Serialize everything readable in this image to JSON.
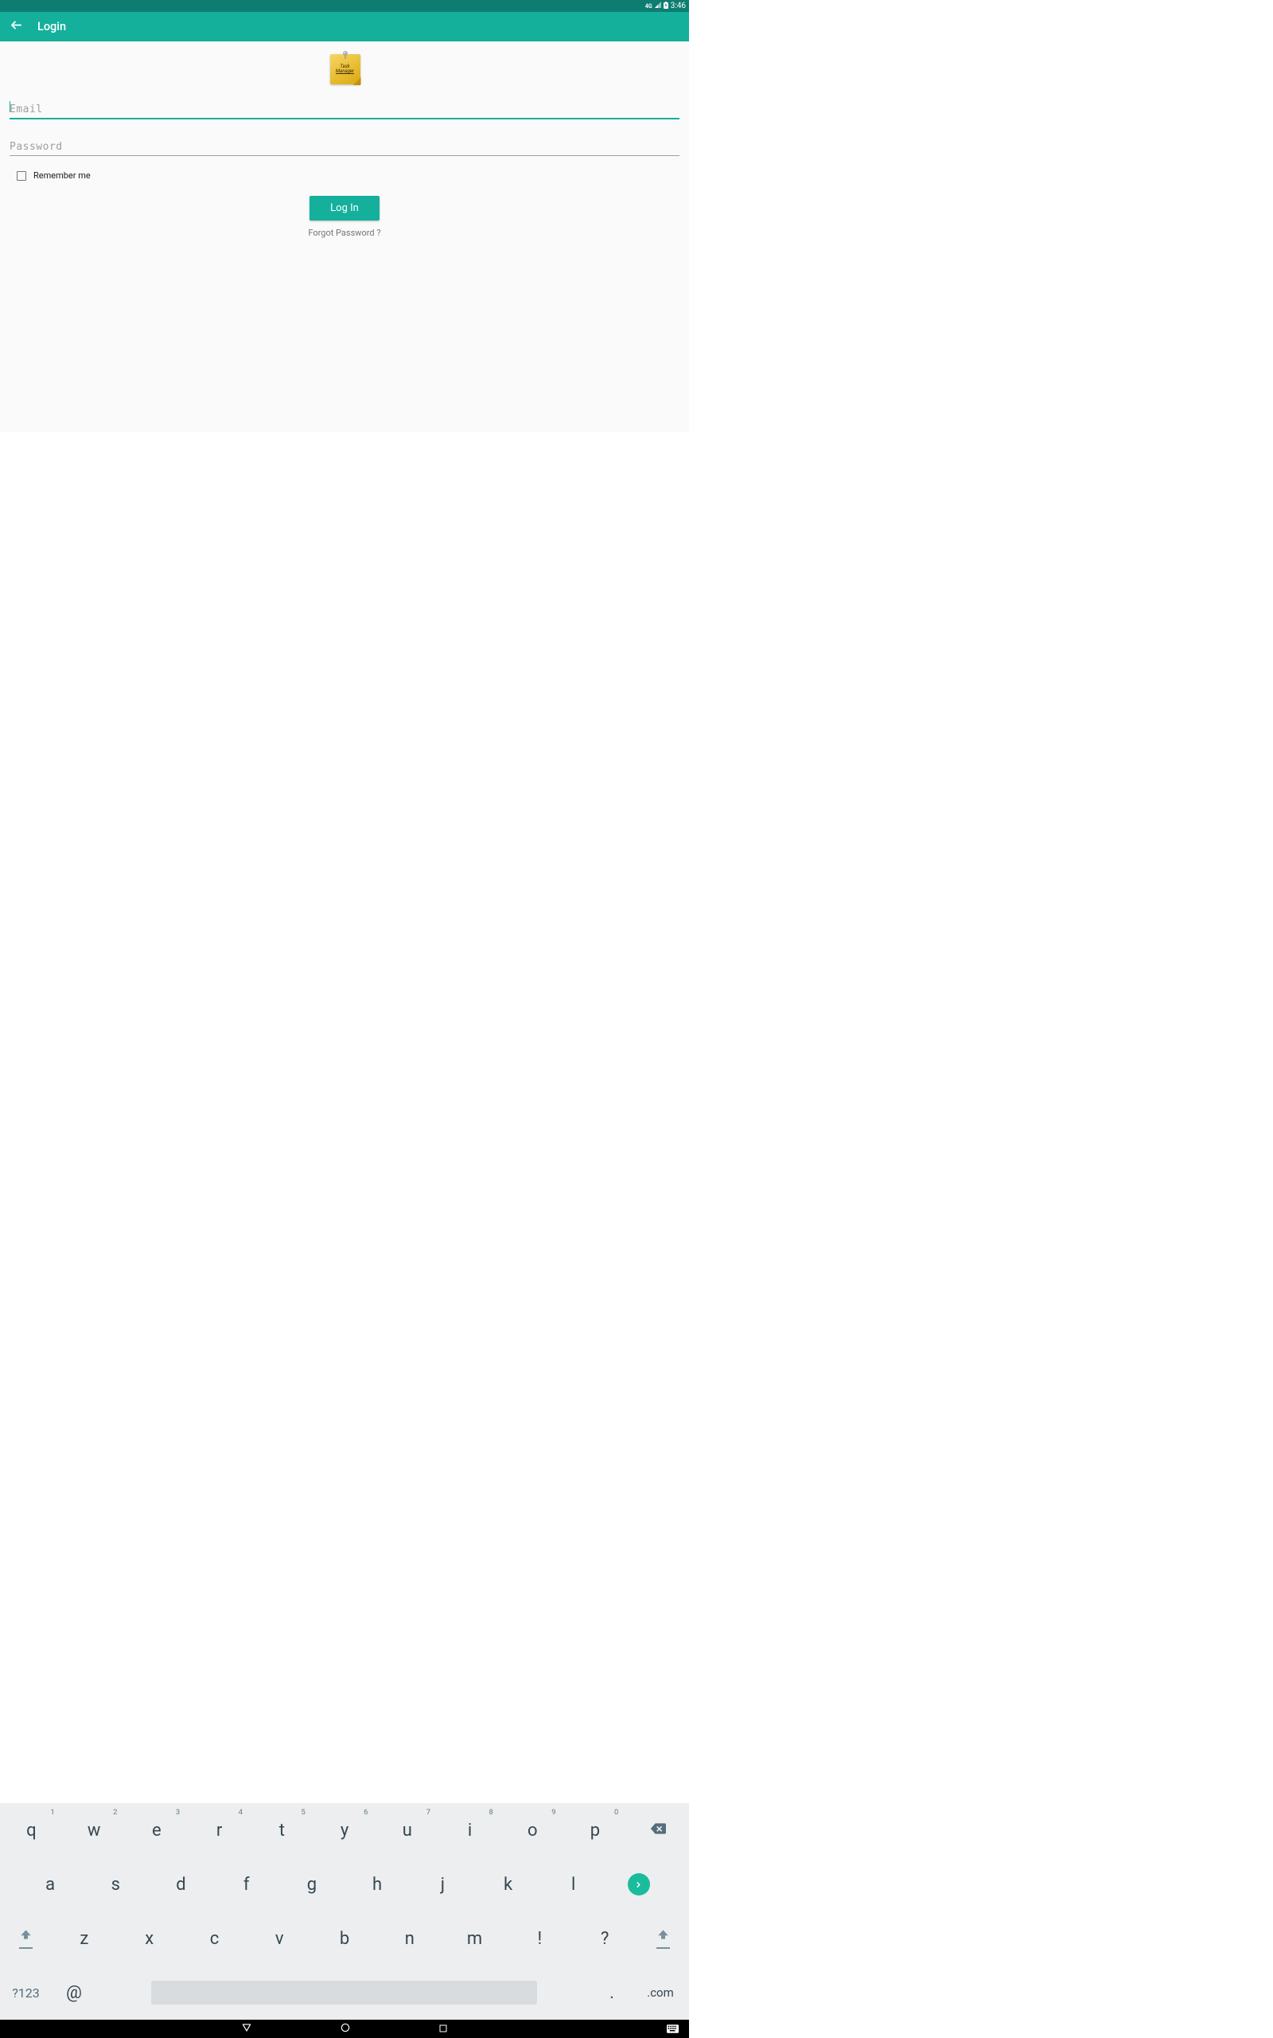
{
  "status": {
    "network": "4G",
    "time": "3:46"
  },
  "header": {
    "title": "Login"
  },
  "logo": {
    "line1": "Task",
    "line2": "Manager"
  },
  "form": {
    "email_placeholder": "Email",
    "password_placeholder": "Password",
    "remember_label": "Remember me",
    "login_button": "Log In",
    "forgot_link": "Forgot Password ?"
  },
  "keyboard": {
    "row1": [
      "q",
      "w",
      "e",
      "r",
      "t",
      "y",
      "u",
      "i",
      "o",
      "p"
    ],
    "row1_nums": [
      "1",
      "2",
      "3",
      "4",
      "5",
      "6",
      "7",
      "8",
      "9",
      "0"
    ],
    "row2": [
      "a",
      "s",
      "d",
      "f",
      "g",
      "h",
      "j",
      "k",
      "l"
    ],
    "row3": [
      "z",
      "x",
      "c",
      "v",
      "b",
      "n",
      "m",
      "!",
      "?"
    ],
    "sym": "?123",
    "at": "@",
    "dot": ".",
    "com": ".com"
  }
}
